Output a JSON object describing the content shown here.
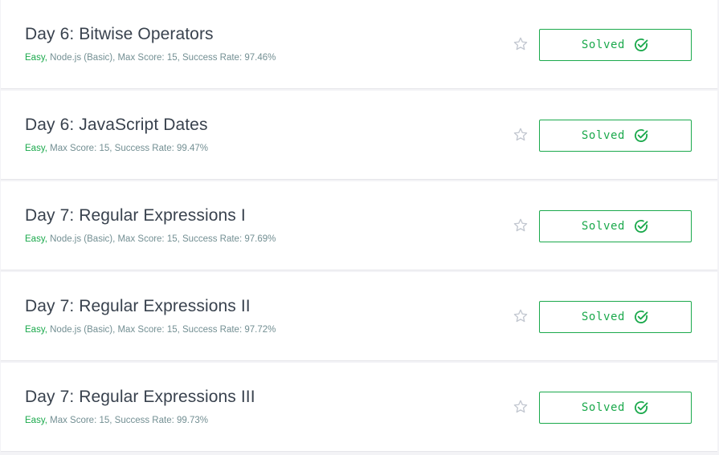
{
  "challenges": [
    {
      "title": "Day 6: Bitwise Operators",
      "difficulty": "Easy,",
      "details": " Node.js (Basic), Max Score: 15, Success Rate: 97.46%",
      "status": "Solved",
      "star_icon": "star-outline-icon",
      "check_icon": "check-circle-icon"
    },
    {
      "title": "Day 6: JavaScript Dates",
      "difficulty": "Easy,",
      "details": " Max Score: 15, Success Rate: 99.47%",
      "status": "Solved",
      "star_icon": "star-outline-icon",
      "check_icon": "check-circle-icon"
    },
    {
      "title": "Day 7: Regular Expressions I",
      "difficulty": "Easy,",
      "details": " Node.js (Basic), Max Score: 15, Success Rate: 97.69%",
      "status": "Solved",
      "star_icon": "star-outline-icon",
      "check_icon": "check-circle-icon"
    },
    {
      "title": "Day 7: Regular Expressions II",
      "difficulty": "Easy,",
      "details": " Node.js (Basic), Max Score: 15, Success Rate: 97.72%",
      "status": "Solved",
      "star_icon": "star-outline-icon",
      "check_icon": "check-circle-icon"
    },
    {
      "title": "Day 7: Regular Expressions III",
      "difficulty": "Easy,",
      "details": " Max Score: 15, Success Rate: 99.73%",
      "status": "Solved",
      "star_icon": "star-outline-icon",
      "check_icon": "check-circle-icon"
    }
  ],
  "colors": {
    "accent_green": "#1ba94c",
    "title_text": "#39424e",
    "meta_text": "#738f93",
    "star_outline": "#c2c7d0"
  }
}
